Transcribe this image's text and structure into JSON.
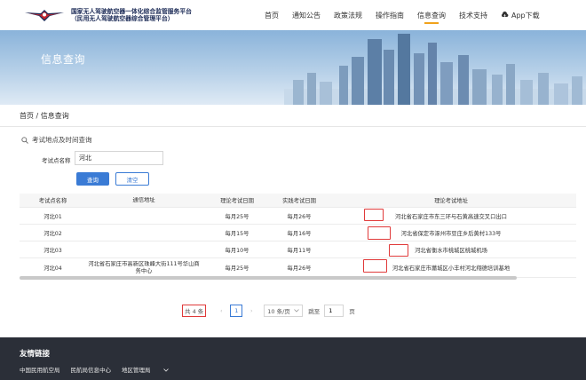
{
  "header": {
    "title_line1": "国家无人驾驶航空器一体化综合监管服务平台",
    "title_line2": "（民用无人驾驶航空器综合管理平台）",
    "nav": [
      "首页",
      "通知公告",
      "政策法规",
      "操作指南",
      "信息查询",
      "技术支持",
      "App下载"
    ],
    "active_nav": "信息查询"
  },
  "banner": {
    "title": "信息查询"
  },
  "breadcrumb": {
    "home": "首页",
    "sep": "/",
    "current": "信息查询"
  },
  "query": {
    "title": "考试地点及时间查询",
    "field_label": "考试点名称",
    "field_value": "河北",
    "search_label": "查询",
    "clear_label": "清空"
  },
  "table": {
    "columns": [
      "考试点名称",
      "通信地址",
      "理论考试日期",
      "实践考试日期",
      "理论考试地址"
    ],
    "rows": [
      [
        "河北01",
        "",
        "每月25号",
        "每月26号",
        "河北省石家庄市东三环与石黄高速交叉口出口"
      ],
      [
        "河北02",
        "",
        "每月15号",
        "每月16号",
        "河北省保定市涿州市豆庄乡后黄村133号"
      ],
      [
        "河北03",
        "",
        "每月10号",
        "每月11号",
        "河北省衡水市桃城区桃城机场"
      ],
      [
        "河北04",
        "河北省石家庄市高新区珠峰大街111号华山商务中心",
        "每月25号",
        "每月26号",
        "河北省石家庄市藁城区小丰村河北翔德培训基地"
      ]
    ]
  },
  "pagination": {
    "total": "共 4 条",
    "prev": "‹",
    "page": "1",
    "next": "›",
    "page_size": "10 条/页",
    "jump_label": "跳至",
    "jump_value": "1",
    "page_unit": "页"
  },
  "footer": {
    "title": "友情链接",
    "links": [
      "中国民用航空局",
      "民航局信息中心",
      "地区管理局"
    ]
  },
  "colors": {
    "accent": "#3a7bd5",
    "highlight": "#e03a3a",
    "footer_bg": "#2b2f38",
    "nav_active": "#f0a21b"
  }
}
